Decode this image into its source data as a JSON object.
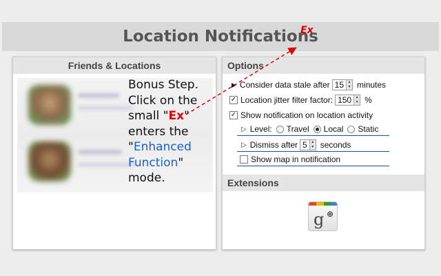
{
  "header": {
    "title": "Location Notifications",
    "ex_label": "Ex"
  },
  "friends_panel": {
    "heading": "Friends & Locations",
    "bonus": {
      "line1": "Bonus Step.",
      "line2": "Click on the",
      "line3_pre": "small \"",
      "ex": "Ex",
      "line3_post": "\"",
      "line4": "enters the",
      "line5_pre": "\"",
      "enhanced": "Enhanced",
      "function": "Function",
      "line6_post": "\"",
      "line7": "mode."
    }
  },
  "options_panel": {
    "heading": "Options",
    "stale": {
      "label": "Consider data stale after",
      "value": "15",
      "unit": "minutes"
    },
    "jitter": {
      "label": "Location jitter filter factor:",
      "value": "150",
      "unit": "%",
      "checked": true
    },
    "show_notif": {
      "label": "Show notification on location activity",
      "checked": true
    },
    "level": {
      "label": "Level:",
      "options": [
        "Travel",
        "Local",
        "Static"
      ],
      "selected": "Local"
    },
    "dismiss": {
      "label": "Dismiss after",
      "value": "5",
      "unit": "seconds"
    },
    "show_map": {
      "label": "Show map in notification",
      "checked": false
    }
  },
  "extensions_panel": {
    "heading": "Extensions",
    "icon": "google-plus-icon"
  },
  "colors": {
    "accent_red": "#e00000",
    "link_blue": "#1a5fd6",
    "underline_blue": "#1d4ea0"
  }
}
